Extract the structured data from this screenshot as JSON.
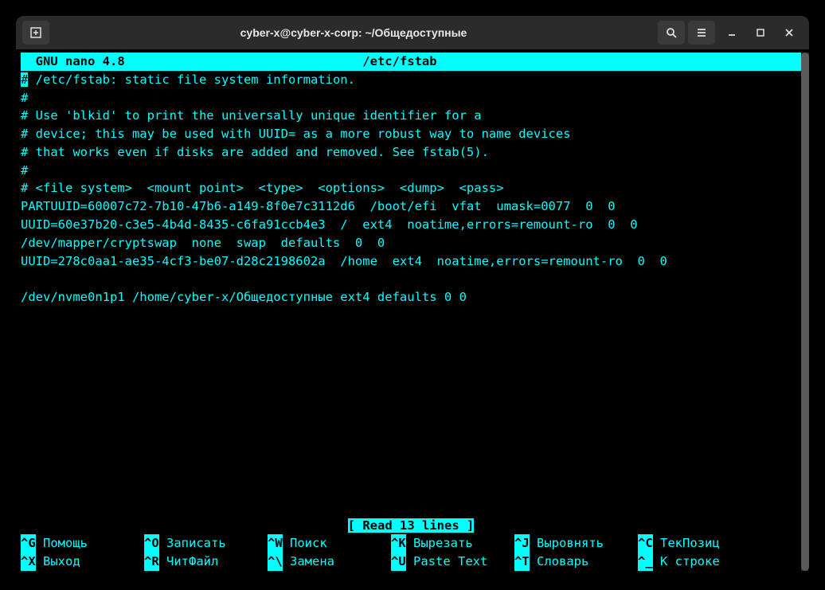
{
  "titlebar": {
    "title": "cyber-x@cyber-x-corp: ~/Общедоступные"
  },
  "editor": {
    "app_name": "  GNU nano 4.8",
    "file_path": "/etc/fstab",
    "lines": [
      " /etc/fstab: static file system information.",
      "#",
      "# Use 'blkid' to print the universally unique identifier for a",
      "# device; this may be used with UUID= as a more robust way to name devices",
      "# that works even if disks are added and removed. See fstab(5).",
      "#",
      "# <file system>  <mount point>  <type>  <options>  <dump>  <pass>",
      "PARTUUID=60007c72-7b10-47b6-a149-8f0e7c3112d6  /boot/efi  vfat  umask=0077  0  0",
      "UUID=60e37b20-c3e5-4b4d-8435-c6fa91ccb4e3  /  ext4  noatime,errors=remount-ro  0  0",
      "/dev/mapper/cryptswap  none  swap  defaults  0  0",
      "UUID=278c0aa1-ae35-4cf3-be07-d28c2198602a  /home  ext4  noatime,errors=remount-ro  0  0",
      "",
      "/dev/nvme0n1p1 /home/cyber-x/Общедоступные ext4 defaults 0 0"
    ],
    "cursor_char": "#",
    "status": "[ Read 13 lines ]"
  },
  "shortcuts": {
    "row1": [
      {
        "key": "^G",
        "label": "Помощь"
      },
      {
        "key": "^O",
        "label": "Записать"
      },
      {
        "key": "^W",
        "label": "Поиск"
      },
      {
        "key": "^K",
        "label": "Вырезать"
      },
      {
        "key": "^J",
        "label": "Выровнять"
      },
      {
        "key": "^C",
        "label": "ТекПозиц"
      }
    ],
    "row2": [
      {
        "key": "^X",
        "label": "Выход"
      },
      {
        "key": "^R",
        "label": "ЧитФайл"
      },
      {
        "key": "^\\",
        "label": "Замена"
      },
      {
        "key": "^U",
        "label": "Paste Text"
      },
      {
        "key": "^T",
        "label": "Словарь"
      },
      {
        "key": "^_",
        "label": "К строке"
      }
    ]
  }
}
